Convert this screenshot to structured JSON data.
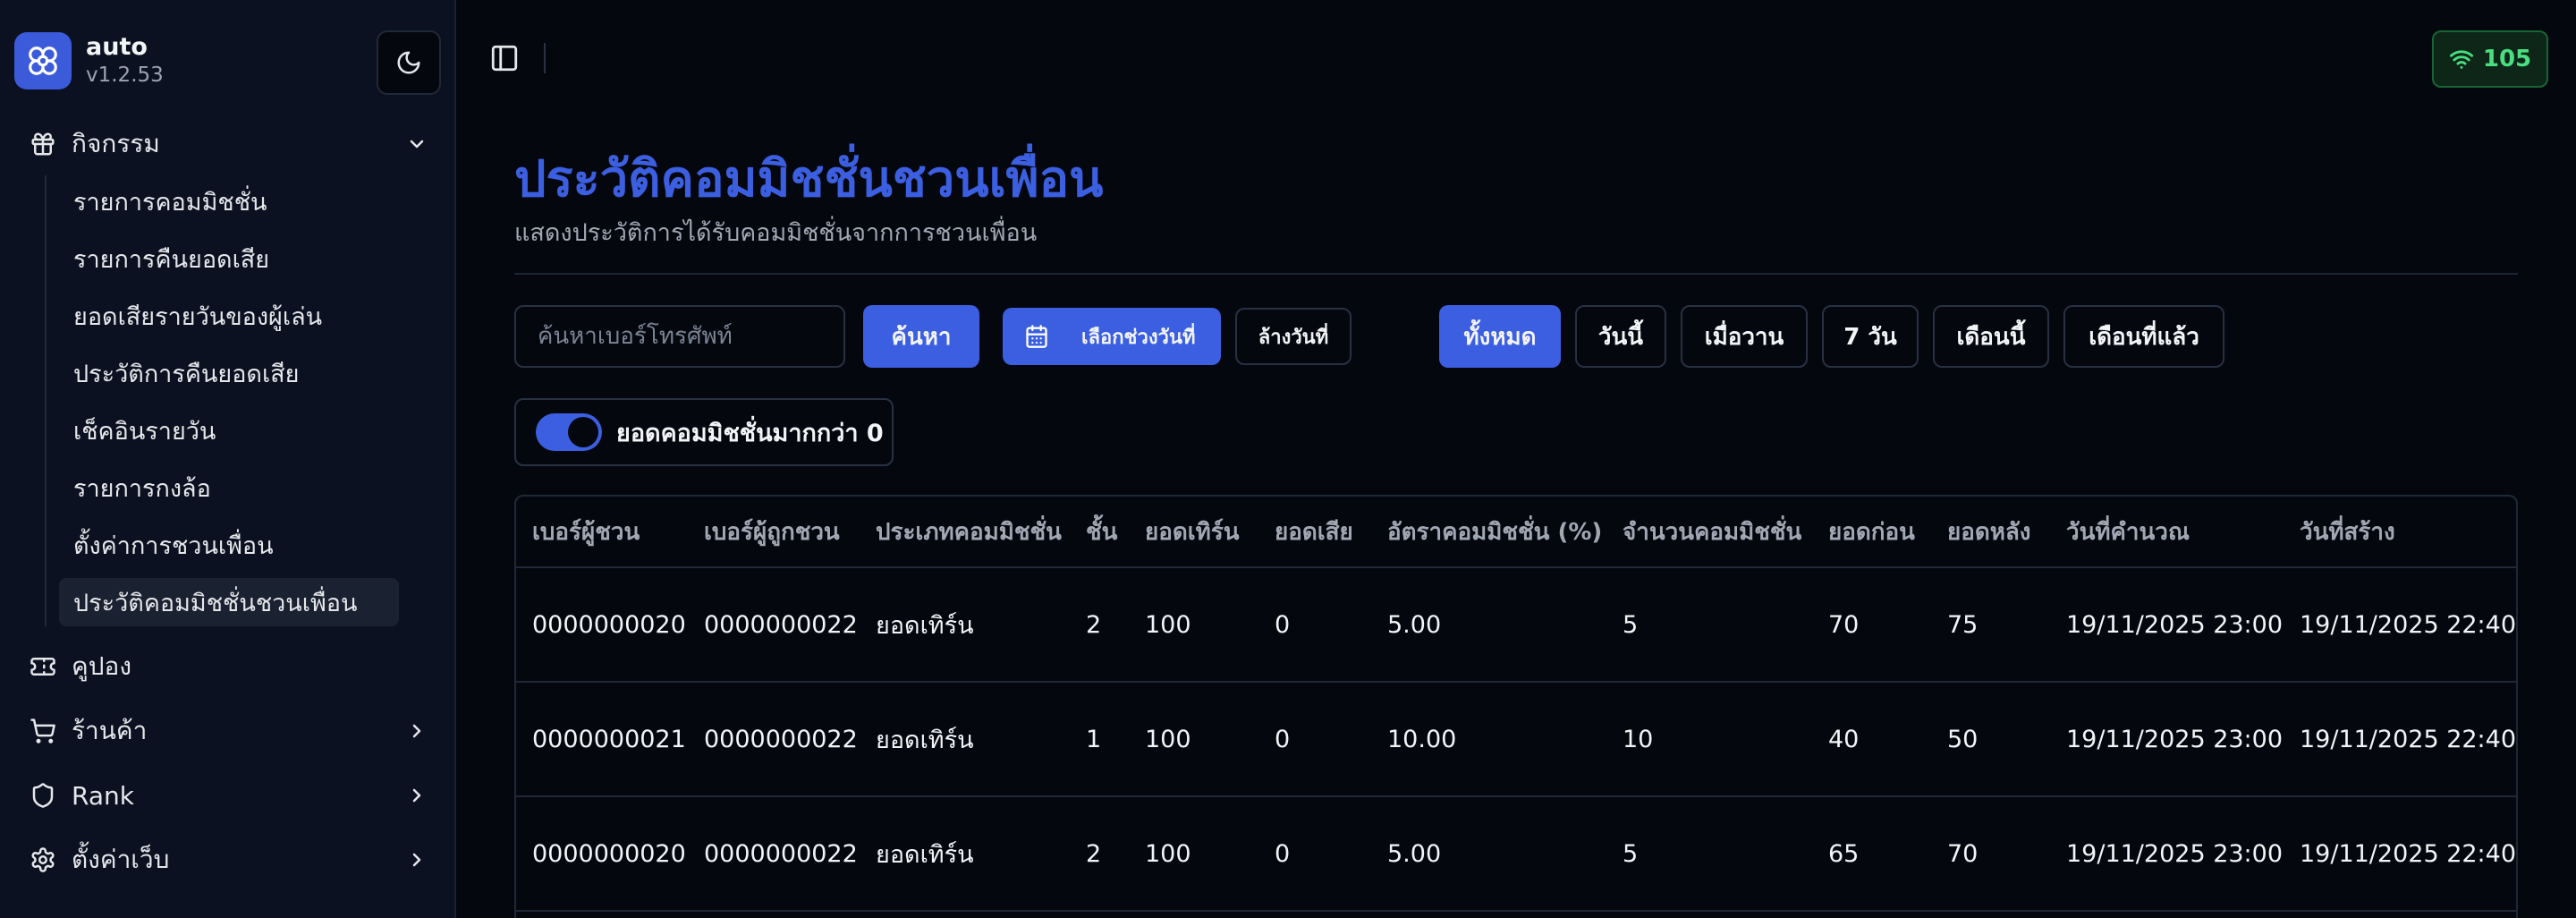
{
  "app": {
    "name": "auto",
    "version": "v1.2.53"
  },
  "sidebar": {
    "groups": {
      "activity": {
        "label": "กิจกรรม"
      },
      "coupon": {
        "label": "คูปอง"
      },
      "shop": {
        "label": "ร้านค้า"
      },
      "rank": {
        "label": "Rank"
      },
      "web_settings": {
        "label": "ตั้งค่าเว็บ"
      }
    },
    "items": [
      "รายการคอมมิชชั่น",
      "รายการคืนยอดเสีย",
      "ยอดเสียรายวันของผู้เล่น",
      "ประวัติการคืนยอดเสีย",
      "เช็คอินรายวัน",
      "รายการกงล้อ",
      "ตั้งค่าการชวนเพื่อน",
      "ประวัติคอมมิชชั่นชวนเพื่อน"
    ],
    "active_index": 7
  },
  "topbar": {
    "signal_value": "105"
  },
  "page": {
    "title": "ประวัติคอมมิชชั่นชวนเพื่อน",
    "subtitle": "แสดงประวัติการได้รับคอมมิชชั่นจากการชวนเพื่อน"
  },
  "filters": {
    "search_placeholder": "ค้นหาเบอร์โทรศัพท์",
    "search_button": "ค้นหา",
    "date_range_button": "เลือกช่วงวันที่",
    "clear_date_button": "ล้างวันที่",
    "quick": [
      "ทั้งหมด",
      "วันนี้",
      "เมื่อวาน",
      "7 วัน",
      "เดือนนี้",
      "เดือนที่แล้ว"
    ],
    "quick_active_index": 0,
    "toggle_label": "ยอดคอมมิชชั่นมากกว่า 0",
    "toggle_on": true
  },
  "table": {
    "columns": [
      "เบอร์ผู้ชวน",
      "เบอร์ผู้ถูกชวน",
      "ประเภทคอมมิชชั่น",
      "ชั้น",
      "ยอดเทิร์น",
      "ยอดเสีย",
      "อัตราคอมมิชชั่น (%)",
      "จำนวนคอมมิชชั่น",
      "ยอดก่อน",
      "ยอดหลัง",
      "วันที่คำนวณ",
      "วันที่สร้าง"
    ],
    "rows": [
      [
        "0000000020",
        "0000000022",
        "ยอดเทิร์น",
        "2",
        "100",
        "0",
        "5.00",
        "5",
        "70",
        "75",
        "19/11/2025 23:00",
        "19/11/2025 22:40"
      ],
      [
        "0000000021",
        "0000000022",
        "ยอดเทิร์น",
        "1",
        "100",
        "0",
        "10.00",
        "10",
        "40",
        "50",
        "19/11/2025 23:00",
        "19/11/2025 22:40"
      ],
      [
        "0000000020",
        "0000000022",
        "ยอดเทิร์น",
        "2",
        "100",
        "0",
        "5.00",
        "5",
        "65",
        "70",
        "19/11/2025 23:00",
        "19/11/2025 22:40"
      ]
    ]
  },
  "colors": {
    "accent": "#3b5fe0",
    "background": "#05070f",
    "sidebar": "#0b1120",
    "success": "#4ade80"
  },
  "icons": {
    "logo": "flower-logo-icon",
    "theme": "moon-icon",
    "panel": "panel-toggle-icon",
    "signal": "wifi-icon",
    "activity": "gift-icon",
    "coupon": "ticket-icon",
    "shop": "cart-icon",
    "rank": "shield-icon",
    "web_settings": "gear-icon",
    "calendar": "calendar-icon"
  }
}
